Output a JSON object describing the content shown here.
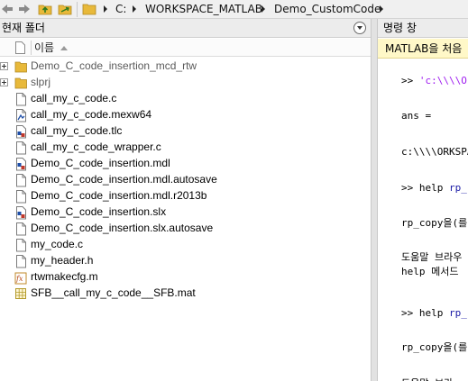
{
  "toolbar": {
    "path": [
      "C:",
      "WORKSPACE_MATLAB",
      "Demo_CustomCode"
    ]
  },
  "left_pane": {
    "title": "현재 폴더",
    "column_name": "이름",
    "files": [
      {
        "name": "Demo_C_code_insertion_mcd_rtw",
        "icon": "folder-icon",
        "expandable": true,
        "dim": true
      },
      {
        "name": "slprj",
        "icon": "folder-icon",
        "expandable": true,
        "dim": true
      },
      {
        "name": "call_my_c_code.c",
        "icon": "c-file-icon",
        "expandable": false,
        "dim": false
      },
      {
        "name": "call_my_c_code.mexw64",
        "icon": "mex-file-icon",
        "expandable": false,
        "dim": false
      },
      {
        "name": "call_my_c_code.tlc",
        "icon": "tlc-file-icon",
        "expandable": false,
        "dim": false
      },
      {
        "name": "call_my_c_code_wrapper.c",
        "icon": "c-file-icon",
        "expandable": false,
        "dim": false
      },
      {
        "name": "Demo_C_code_insertion.mdl",
        "icon": "simulink-model-icon",
        "expandable": false,
        "dim": false
      },
      {
        "name": "Demo_C_code_insertion.mdl.autosave",
        "icon": "file-icon",
        "expandable": false,
        "dim": false
      },
      {
        "name": "Demo_C_code_insertion.mdl.r2013b",
        "icon": "file-icon",
        "expandable": false,
        "dim": false
      },
      {
        "name": "Demo_C_code_insertion.slx",
        "icon": "simulink-model-icon",
        "expandable": false,
        "dim": false
      },
      {
        "name": "Demo_C_code_insertion.slx.autosave",
        "icon": "file-icon",
        "expandable": false,
        "dim": false
      },
      {
        "name": "my_code.c",
        "icon": "c-file-icon",
        "expandable": false,
        "dim": false
      },
      {
        "name": "my_header.h",
        "icon": "h-file-icon",
        "expandable": false,
        "dim": false
      },
      {
        "name": "rtwmakecfg.m",
        "icon": "m-function-icon",
        "expandable": false,
        "dim": false
      },
      {
        "name": "SFB__call_my_c_code__SFB.mat",
        "icon": "mat-file-icon",
        "expandable": false,
        "dim": false
      }
    ]
  },
  "right_pane": {
    "title": "명령 창",
    "notice": "MATLAB을 처음 ",
    "lines": [
      {
        "prompt": ">> ",
        "text": "'c:\\\\\\\\OF",
        "kind": "str"
      },
      {
        "prompt": "",
        "text": "ans =",
        "kind": "plain"
      },
      {
        "prompt": "",
        "text": "c:\\\\\\\\ORKSPA",
        "kind": "plain"
      },
      {
        "prompt": ">> ",
        "text": "help ",
        "rest": "rp_",
        "kind": "cmd"
      },
      {
        "prompt": "",
        "text": "rp_copy을(를",
        "kind": "plain"
      },
      {
        "prompt": "",
        "text": "도움말 브라우",
        "kind": "plain"
      },
      {
        "prompt": "",
        "text": "help 메서드",
        "kind": "plain"
      },
      {
        "prompt": ">> ",
        "text": "help ",
        "rest": "rp_",
        "kind": "cmd"
      },
      {
        "prompt": "",
        "text": "rp_copy을(를",
        "kind": "plain"
      },
      {
        "prompt": "",
        "text": "도움말 브라",
        "kind": "plain"
      }
    ]
  },
  "colors": {
    "folder": "#e8b93a",
    "notice_bg": "#fff8c8",
    "string": "#a020f0",
    "function": "#1a1aa6"
  }
}
